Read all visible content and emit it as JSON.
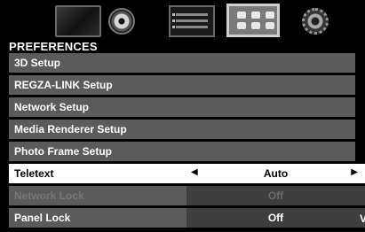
{
  "icons": [
    "tv-icon",
    "disc-icon",
    "list-icon",
    "preferences-icon",
    "gear-icon"
  ],
  "title": "PREFERENCES",
  "menu": {
    "setup_3d": "3D Setup",
    "regza": "REGZA-LINK Setup",
    "network": "Network Setup",
    "media": "Media Renderer Setup",
    "photo": "Photo Frame Setup",
    "teletext": {
      "label": "Teletext",
      "value": "Auto"
    },
    "network_lock": {
      "label": "Network Lock",
      "value": "Off"
    },
    "panel_lock": {
      "label": "Panel Lock",
      "value": "Off"
    }
  },
  "glyphs": {
    "left": "◀",
    "right": "▶",
    "down": "V"
  },
  "colors": {
    "background": "#000000",
    "item": "#5b5b5b",
    "value_cell": "#3e3e3e",
    "selected": "#ffffff"
  }
}
